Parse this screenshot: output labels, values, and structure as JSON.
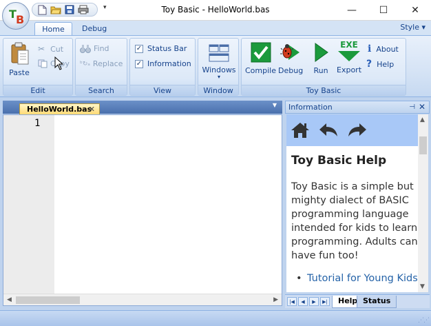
{
  "window": {
    "title": "Toy Basic - HelloWorld.bas",
    "minimize": "—",
    "maximize": "☐",
    "close": "✕"
  },
  "app_orb": {
    "letter1": "T",
    "letter2": "B"
  },
  "quick_access": {
    "dropdown": "▾"
  },
  "tabs": {
    "home": "Home",
    "debug": "Debug",
    "style": "Style ▾"
  },
  "ribbon": {
    "edit": {
      "label": "Edit",
      "paste": "Paste",
      "cut": "Cut",
      "copy": "Copy"
    },
    "search": {
      "label": "Search",
      "find": "Find",
      "replace": "Replace"
    },
    "view": {
      "label": "View",
      "status_bar": "Status Bar",
      "information": "Information",
      "status_bar_checked": true,
      "information_checked": true
    },
    "window": {
      "label": "Window",
      "windows": "Windows",
      "windows_arrow": "▾"
    },
    "toy_basic": {
      "label": "Toy Basic",
      "compile": "Compile",
      "debug": "Debug",
      "run": "Run",
      "export": "Export",
      "export_icon_text": "EXE",
      "about": "About",
      "help": "Help"
    }
  },
  "document": {
    "tab_name": "HelloWorld.bas",
    "tab_close": "✕",
    "line_numbers": [
      "1"
    ]
  },
  "info_panel": {
    "title": "Information",
    "pin": "⊣",
    "close": "✕",
    "help_heading": "Toy Basic Help",
    "help_text": "Toy Basic is a simple but mighty dialect of BASIC programming language intended for kids to learn programming. Adults can have fun too!",
    "bullet_link": "Tutorial for Young Kids",
    "tabs": [
      "Help",
      "Status"
    ]
  },
  "colors": {
    "ribbon_text": "#15428b",
    "accent_green": "#1b9a3c",
    "link": "#2563a8"
  }
}
